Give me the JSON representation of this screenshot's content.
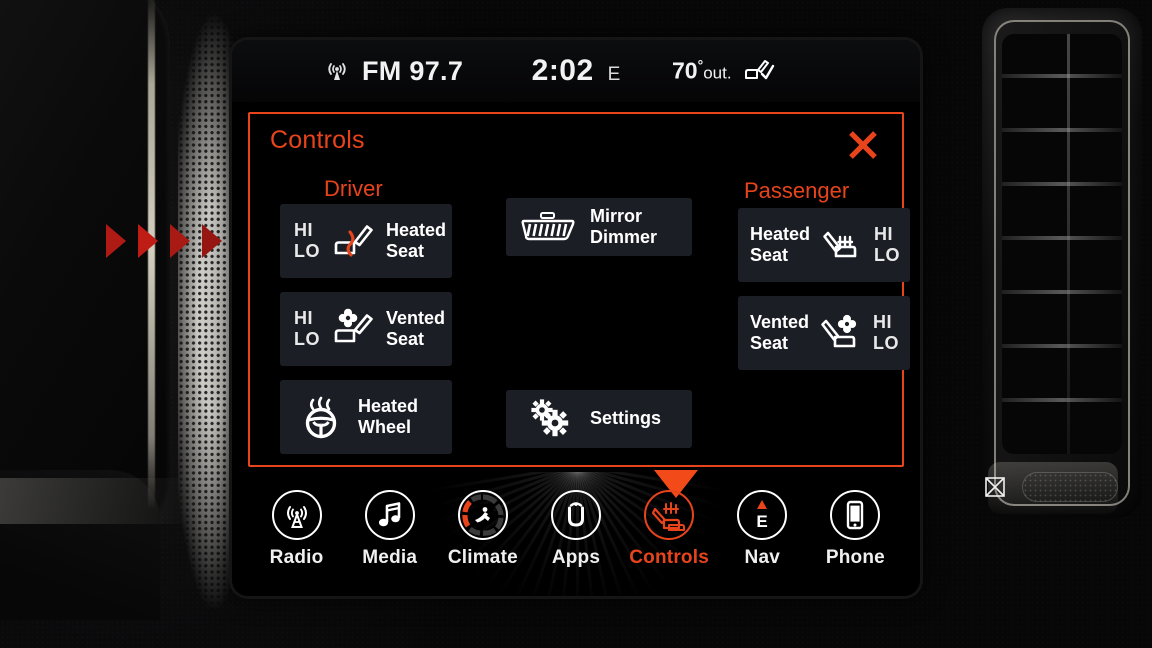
{
  "status_bar": {
    "radio_icon": "broadcast-antenna-icon",
    "source": "FM 97.7",
    "time": "2:02",
    "heading": "E",
    "temperature": "70",
    "degree": "°",
    "temp_unit": "out.",
    "seat_indicator_icon": "heated-seat-indicator-icon"
  },
  "panel": {
    "title": "Controls",
    "close_icon": "close-icon",
    "sections": {
      "driver_label": "Driver",
      "passenger_label": "Passenger"
    },
    "hi": "HI",
    "lo": "LO",
    "driver_buttons": [
      {
        "label": "Heated\nSeat",
        "icon": "heated-seat-icon",
        "hi": "HI",
        "lo": "LO"
      },
      {
        "label": "Vented\nSeat",
        "icon": "vented-seat-icon",
        "hi": "HI",
        "lo": "LO"
      },
      {
        "label": "Heated\nWheel",
        "icon": "heated-steering-wheel-icon"
      }
    ],
    "center_buttons": [
      {
        "label": "Mirror\nDimmer",
        "icon": "mirror-dimmer-icon"
      },
      {
        "label": "Settings",
        "icon": "gear-icon"
      }
    ],
    "passenger_buttons": [
      {
        "label": "Heated\nSeat",
        "icon": "heated-seat-icon",
        "hi": "HI",
        "lo": "LO"
      },
      {
        "label": "Vented\nSeat",
        "icon": "vented-seat-icon",
        "hi": "HI",
        "lo": "LO"
      }
    ]
  },
  "nav_bar": {
    "items": [
      {
        "label": "Radio",
        "icon": "radio-tower-icon",
        "active": false
      },
      {
        "label": "Media",
        "icon": "music-note-icon",
        "active": false
      },
      {
        "label": "Climate",
        "icon": "climate-dial-icon",
        "active": false
      },
      {
        "label": "Apps",
        "icon": "apps-uconnect-icon",
        "active": false
      },
      {
        "label": "Controls",
        "icon": "controls-seat-icon",
        "active": true
      },
      {
        "label": "Nav",
        "icon": "compass-east-icon",
        "active": false
      },
      {
        "label": "Phone",
        "icon": "phone-icon",
        "active": false
      }
    ]
  },
  "colors": {
    "accent": "#e8441c",
    "button_bg": "#1b1e25",
    "screen_bg": "#000000",
    "text": "#ffffff"
  }
}
